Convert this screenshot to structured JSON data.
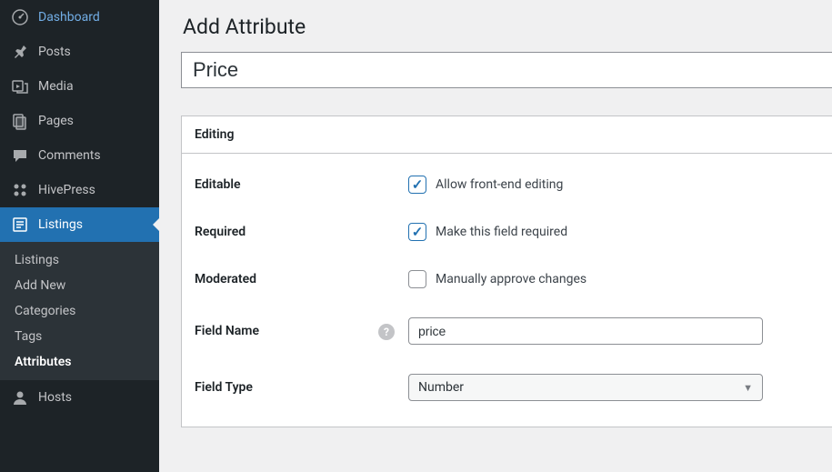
{
  "sidebar": {
    "dashboard": "Dashboard",
    "posts": "Posts",
    "media": "Media",
    "pages": "Pages",
    "comments": "Comments",
    "hivepress": "HivePress",
    "listings": "Listings",
    "hosts": "Hosts",
    "submenu": {
      "listings": "Listings",
      "add_new": "Add New",
      "categories": "Categories",
      "tags": "Tags",
      "attributes": "Attributes"
    }
  },
  "page": {
    "title": "Add Attribute",
    "attr_name": "Price"
  },
  "panel": {
    "title": "Editing",
    "editable": {
      "label": "Editable",
      "text": "Allow front-end editing"
    },
    "required": {
      "label": "Required",
      "text": "Make this field required"
    },
    "moderated": {
      "label": "Moderated",
      "text": "Manually approve changes"
    },
    "field_name": {
      "label": "Field Name",
      "value": "price"
    },
    "field_type": {
      "label": "Field Type",
      "value": "Number"
    }
  }
}
